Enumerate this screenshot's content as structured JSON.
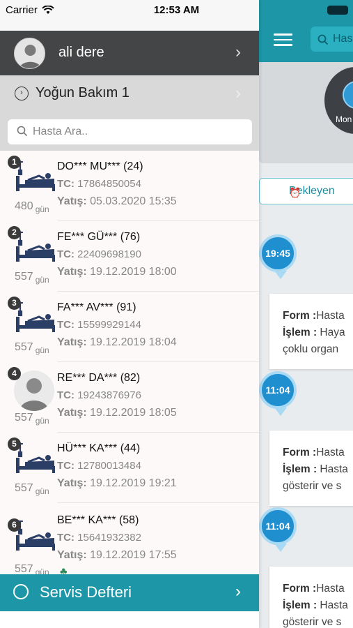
{
  "status_bar": {
    "carrier": "Carrier",
    "time": "12:53 AM"
  },
  "background": {
    "search_placeholder": "Has",
    "monitor_label": "Mon",
    "waiting_button": "Bekleyen",
    "cards": [
      {
        "time": "19:45",
        "form_label": "Form :",
        "form_value": "Hasta",
        "action_label": "İşlem :",
        "action_value": "Haya",
        "extra": "çoklu organ"
      },
      {
        "time": "11:04",
        "form_label": "Form :",
        "form_value": "Hasta",
        "action_label": "İşlem :",
        "action_value": "Hasta",
        "extra": "gösterir ve s"
      },
      {
        "time": "11:04",
        "form_label": "Form :",
        "form_value": "Hasta",
        "action_label": "İşlem :",
        "action_value": "Hasta",
        "extra": "gösterir ve s"
      }
    ]
  },
  "menu": {
    "user_name": "ali dere",
    "ward_name": "Yoğun Bakım 1",
    "search_placeholder": "Hasta Ara..",
    "patients": [
      {
        "index": "1",
        "name": "DO*** MU*** (24)",
        "tc_label": "TC:",
        "tc": "17864850054",
        "stay_label": "Yatış:",
        "stay": "05.03.2020 15:35",
        "days": "480",
        "days_unit": "gün",
        "icon": "bed"
      },
      {
        "index": "2",
        "name": "FE*** GÜ*** (76)",
        "tc_label": "TC:",
        "tc": "22409698190",
        "stay_label": "Yatış:",
        "stay": "19.12.2019 18:00",
        "days": "557",
        "days_unit": "gün",
        "icon": "bed"
      },
      {
        "index": "3",
        "name": "FA*** AV*** (91)",
        "tc_label": "TC:",
        "tc": "15599929144",
        "stay_label": "Yatış:",
        "stay": "19.12.2019 18:04",
        "days": "557",
        "days_unit": "gün",
        "icon": "bed"
      },
      {
        "index": "4",
        "name": "RE*** DA*** (82)",
        "tc_label": "TC:",
        "tc": "19243876976",
        "stay_label": "Yatış:",
        "stay": "19.12.2019 18:05",
        "days": "557",
        "days_unit": "gün",
        "icon": "photo"
      },
      {
        "index": "5",
        "name": "HÜ*** KA*** (44)",
        "tc_label": "TC:",
        "tc": "12780013484",
        "stay_label": "Yatış:",
        "stay": "19.12.2019 19:21",
        "days": "557",
        "days_unit": "gün",
        "icon": "bed"
      },
      {
        "index": "6",
        "name": "BE*** KA*** (58)",
        "tc_label": "TC:",
        "tc": "15641932382",
        "stay_label": "Yatış:",
        "stay": "19.12.2019 17:55",
        "days": "557",
        "days_unit": "gün",
        "icon": "bed"
      }
    ],
    "service_label": "Servis Defteri"
  }
}
